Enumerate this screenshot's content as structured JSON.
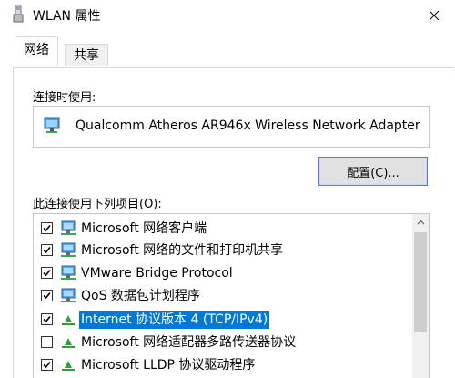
{
  "window": {
    "title": "WLAN 属性"
  },
  "tabs": [
    {
      "label": "网络",
      "active": true
    },
    {
      "label": "共享",
      "active": false
    }
  ],
  "connect_using": {
    "label": "连接时使用:",
    "adapter_name": "Qualcomm Atheros AR946x Wireless Network Adapter",
    "icon": "network-adapter-icon"
  },
  "configure_button": {
    "label": "配置(C)..."
  },
  "items_section": {
    "label": "此连接使用下列项目(O):",
    "items": [
      {
        "label": "Microsoft 网络客户端",
        "checked": true,
        "icon": "network-client-icon",
        "selected": false
      },
      {
        "label": "Microsoft 网络的文件和打印机共享",
        "checked": true,
        "icon": "network-client-icon",
        "selected": false
      },
      {
        "label": "VMware Bridge Protocol",
        "checked": true,
        "icon": "network-client-icon",
        "selected": false
      },
      {
        "label": "QoS 数据包计划程序",
        "checked": true,
        "icon": "network-client-icon",
        "selected": false
      },
      {
        "label": "Internet 协议版本 4 (TCP/IPv4)",
        "checked": true,
        "icon": "protocol-icon",
        "selected": true
      },
      {
        "label": "Microsoft 网络适配器多路传送器协议",
        "checked": false,
        "icon": "protocol-icon",
        "selected": false
      },
      {
        "label": "Microsoft LLDP 协议驱动程序",
        "checked": true,
        "icon": "protocol-icon",
        "selected": false
      }
    ]
  },
  "colors": {
    "selection": "#0078d7",
    "protocol_icon": "#2e9d3a",
    "monitor_icon": "#3a7fc8"
  }
}
